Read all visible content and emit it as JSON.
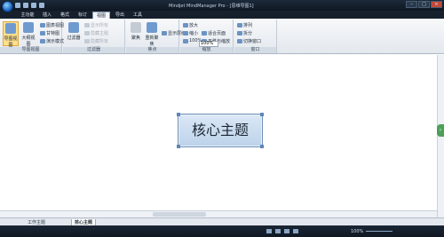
{
  "window": {
    "title": "Mindjet MindManager Pro - [思维导图1]",
    "buttons": [
      "–",
      "□",
      "×"
    ]
  },
  "tabs": [
    "主功能",
    "插入",
    "格式",
    "标订",
    "视图",
    "导出",
    "工具"
  ],
  "active_tab": "视图",
  "ribbon": {
    "groups": [
      {
        "label": "导图视图",
        "items": [
          "导图视图",
          "大纲视图",
          "图表视图",
          "甘特图",
          "展示视图",
          "演示模式"
        ]
      },
      {
        "label": "过滤器",
        "items": [
          "过滤器",
          "显示所有",
          "隐藏主题",
          "隐藏所有"
        ]
      },
      {
        "label": "焦点",
        "items": [
          "聚焦",
          "重新聚焦",
          "显示层级"
        ]
      },
      {
        "label": "缩放",
        "items": [
          "放大",
          "缩小",
          "适合页面",
          "100%",
          "平移与缩放"
        ],
        "zoom_value": "100%"
      },
      {
        "label": "窗口",
        "items": [
          "排列",
          "拆分",
          "切换窗口"
        ]
      }
    ]
  },
  "canvas": {
    "central_topic": "核心主题"
  },
  "doc_tabs": [
    "工作主题",
    "核心主题"
  ],
  "status": {
    "zoom": "100%"
  }
}
